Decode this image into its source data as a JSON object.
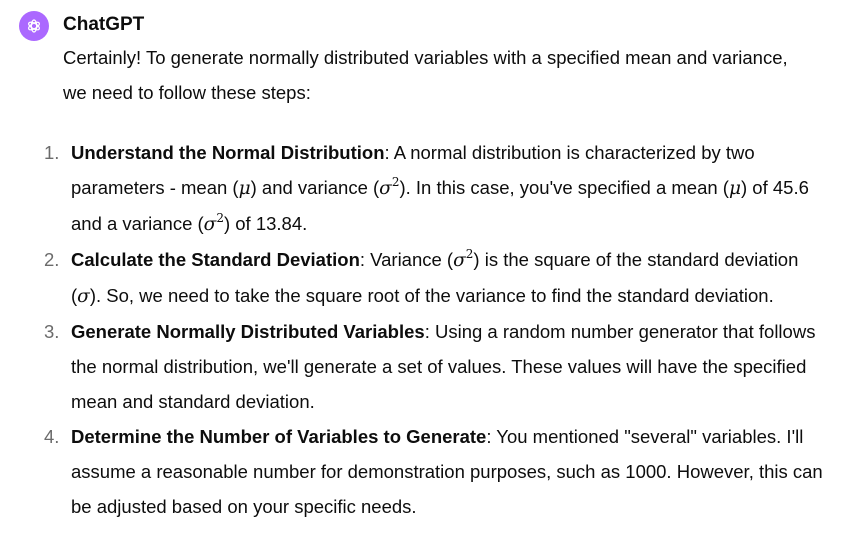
{
  "author": "ChatGPT",
  "avatar_icon": "openai-logo-icon",
  "avatar_color": "#ab68ff",
  "intro": "Certainly! To generate normally distributed variables with a specified mean and variance, we need to follow these steps:",
  "steps": [
    {
      "number": "1.",
      "title": "Understand the Normal Distribution",
      "parts": [
        ": A normal distribution is characterized by two parameters - mean (",
        ") and variance (",
        "). In this case, you've specified a mean (",
        ") of 45.6 and a variance (",
        ") of 13.84."
      ]
    },
    {
      "number": "2.",
      "title": "Calculate the Standard Deviation",
      "parts": [
        ": Variance (",
        ") is the square of the standard deviation (",
        "). So, we need to take the square root of the variance to find the standard deviation."
      ]
    },
    {
      "number": "3.",
      "title": "Generate Normally Distributed Variables",
      "text": ": Using a random number generator that follows the normal distribution, we'll generate a set of values. These values will have the specified mean and standard deviation."
    },
    {
      "number": "4.",
      "title": "Determine the Number of Variables to Generate",
      "text": ": You mentioned \"several\" variables. I'll assume a reasonable number for demonstration purposes, such as 1000. However, this can be adjusted based on your specific needs."
    }
  ],
  "symbols": {
    "mu": "μ",
    "sigma": "σ",
    "squared": "2"
  }
}
